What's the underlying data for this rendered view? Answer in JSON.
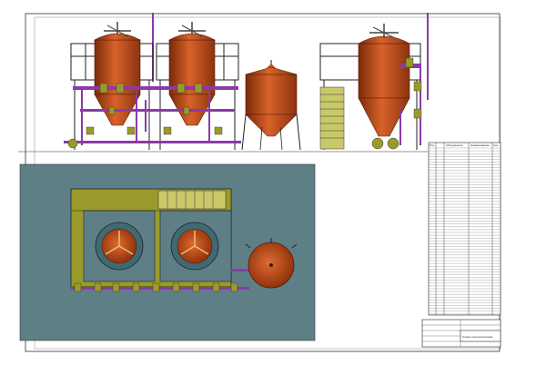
{
  "sheet": {
    "title_block_text": "Схема технологическая",
    "spec_header": [
      "Поз.",
      "Обозначение",
      "Наименование",
      "Кол."
    ]
  },
  "colors": {
    "vessel": "#c4511a",
    "vessel_dark": "#7a2a08",
    "pipe": "#8b3aa8",
    "frame": "#222222",
    "platform": "#9a9a2a",
    "plan_background": "#5f7f87",
    "paper": "#ffffff"
  },
  "views": {
    "elevation": {
      "vessel_count": 4
    },
    "plan": {
      "vessel_count": 3
    }
  }
}
